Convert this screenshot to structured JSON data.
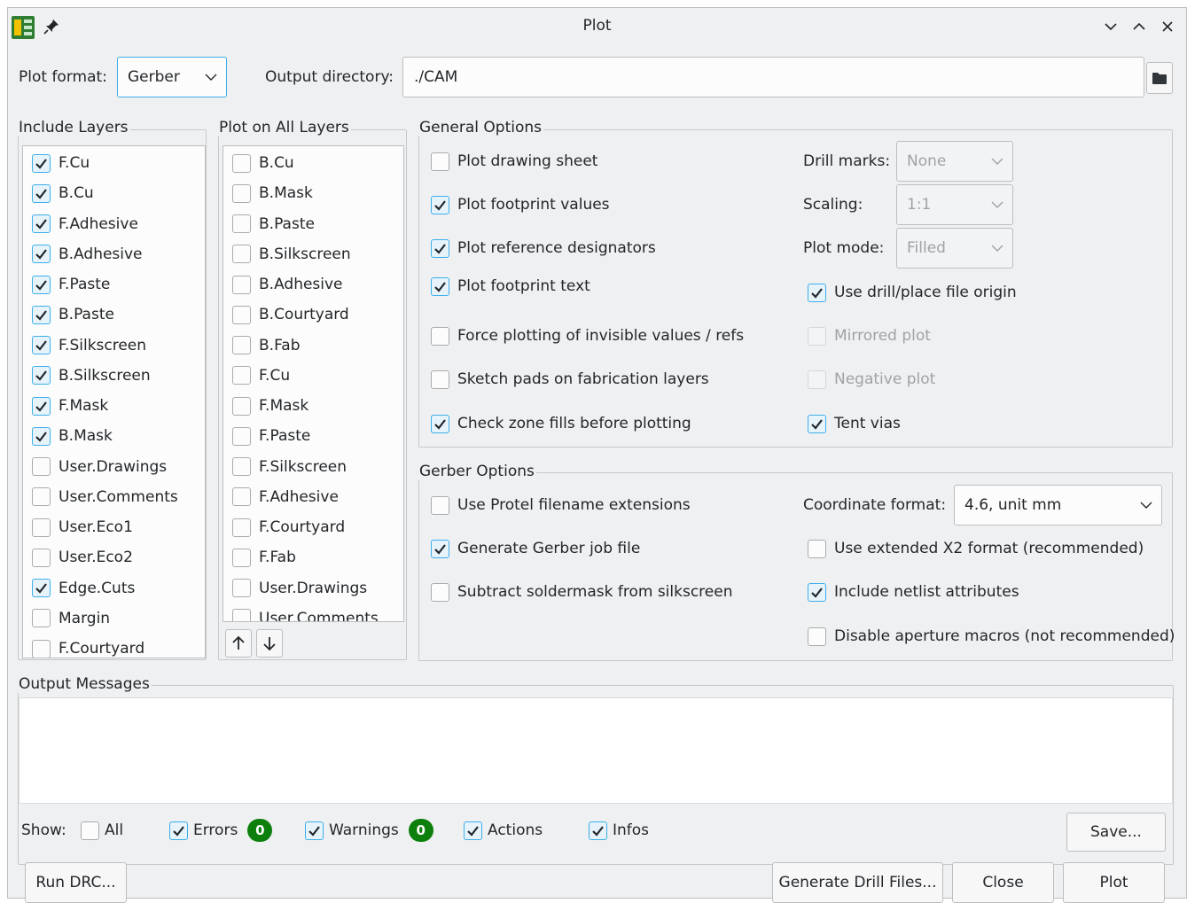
{
  "window": {
    "title": "Plot"
  },
  "top": {
    "plot_format_label": "Plot format:",
    "plot_format_value": "Gerber",
    "output_dir_label": "Output directory:",
    "output_dir_value": "./CAM"
  },
  "include_layers": {
    "title": "Include Layers",
    "items": [
      {
        "label": "F.Cu",
        "checked": true
      },
      {
        "label": "B.Cu",
        "checked": true
      },
      {
        "label": "F.Adhesive",
        "checked": true
      },
      {
        "label": "B.Adhesive",
        "checked": true
      },
      {
        "label": "F.Paste",
        "checked": true
      },
      {
        "label": "B.Paste",
        "checked": true
      },
      {
        "label": "F.Silkscreen",
        "checked": true
      },
      {
        "label": "B.Silkscreen",
        "checked": true
      },
      {
        "label": "F.Mask",
        "checked": true
      },
      {
        "label": "B.Mask",
        "checked": true
      },
      {
        "label": "User.Drawings",
        "checked": false
      },
      {
        "label": "User.Comments",
        "checked": false
      },
      {
        "label": "User.Eco1",
        "checked": false
      },
      {
        "label": "User.Eco2",
        "checked": false
      },
      {
        "label": "Edge.Cuts",
        "checked": true
      },
      {
        "label": "Margin",
        "checked": false
      },
      {
        "label": "F.Courtyard",
        "checked": false
      }
    ]
  },
  "all_layers": {
    "title": "Plot on All Layers",
    "items": [
      {
        "label": "B.Cu",
        "checked": false
      },
      {
        "label": "B.Mask",
        "checked": false
      },
      {
        "label": "B.Paste",
        "checked": false
      },
      {
        "label": "B.Silkscreen",
        "checked": false
      },
      {
        "label": "B.Adhesive",
        "checked": false
      },
      {
        "label": "B.Courtyard",
        "checked": false
      },
      {
        "label": "B.Fab",
        "checked": false
      },
      {
        "label": "F.Cu",
        "checked": false
      },
      {
        "label": "F.Mask",
        "checked": false
      },
      {
        "label": "F.Paste",
        "checked": false
      },
      {
        "label": "F.Silkscreen",
        "checked": false
      },
      {
        "label": "F.Adhesive",
        "checked": false
      },
      {
        "label": "F.Courtyard",
        "checked": false
      },
      {
        "label": "F.Fab",
        "checked": false
      },
      {
        "label": "User.Drawings",
        "checked": false
      },
      {
        "label": "User.Comments",
        "checked": false
      }
    ]
  },
  "general": {
    "title": "General Options",
    "left": [
      {
        "label": "Plot drawing sheet",
        "checked": false
      },
      {
        "label": "Plot footprint values",
        "checked": true
      },
      {
        "label": "Plot reference designators",
        "checked": true
      },
      {
        "label": "Plot footprint text",
        "checked": true
      },
      {
        "label": "Force plotting of invisible values / refs",
        "checked": false
      },
      {
        "label": "Sketch pads on fabrication layers",
        "checked": false
      },
      {
        "label": "Check zone fills before plotting",
        "checked": true
      }
    ],
    "drill_marks_label": "Drill marks:",
    "drill_marks_value": "None",
    "scaling_label": "Scaling:",
    "scaling_value": "1:1",
    "plot_mode_label": "Plot mode:",
    "plot_mode_value": "Filled",
    "right": [
      {
        "label": "Use drill/place file origin",
        "checked": true,
        "disabled": false
      },
      {
        "label": "Mirrored plot",
        "checked": false,
        "disabled": true
      },
      {
        "label": "Negative plot",
        "checked": false,
        "disabled": true
      },
      {
        "label": "Tent vias",
        "checked": true,
        "disabled": false
      }
    ]
  },
  "gerber": {
    "title": "Gerber Options",
    "left": [
      {
        "label": "Use Protel filename extensions",
        "checked": false
      },
      {
        "label": "Generate Gerber job file",
        "checked": true
      },
      {
        "label": "Subtract soldermask from silkscreen",
        "checked": false
      }
    ],
    "coord_label": "Coordinate format:",
    "coord_value": "4.6, unit mm",
    "right": [
      {
        "label": "Use extended X2 format (recommended)",
        "checked": false
      },
      {
        "label": "Include netlist attributes",
        "checked": true
      },
      {
        "label": "Disable aperture macros (not recommended)",
        "checked": false
      }
    ]
  },
  "messages": {
    "title": "Output Messages",
    "show_label": "Show:",
    "filters": [
      {
        "label": "All",
        "checked": false
      },
      {
        "label": "Errors",
        "checked": true,
        "count": "0"
      },
      {
        "label": "Warnings",
        "checked": true,
        "count": "0"
      },
      {
        "label": "Actions",
        "checked": true
      },
      {
        "label": "Infos",
        "checked": true
      }
    ],
    "save_label": "Save..."
  },
  "buttons": {
    "run_drc": "Run DRC...",
    "gen_drill": "Generate Drill Files...",
    "close": "Close",
    "plot": "Plot"
  },
  "colors": {
    "accent": "#3daee9",
    "badge": "#0d7f0d",
    "window_bg": "#eff0f1"
  }
}
